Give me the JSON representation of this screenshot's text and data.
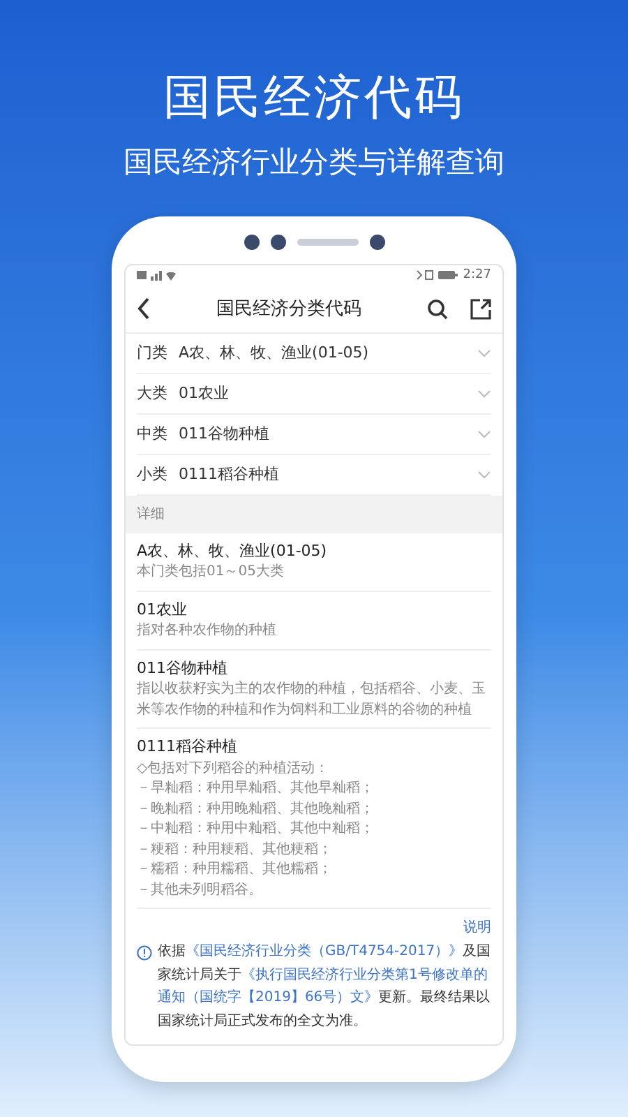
{
  "headline": "国民经济代码",
  "subtitle": "国民经济行业分类与详解查询",
  "status_bar": {
    "time": "2:27"
  },
  "nav": {
    "title": "国民经济分类代码"
  },
  "selectors": [
    {
      "label": "门类",
      "value": "A农、林、牧、渔业(01-05)"
    },
    {
      "label": "大类",
      "value": "01农业"
    },
    {
      "label": "中类",
      "value": "011谷物种植"
    },
    {
      "label": "小类",
      "value": "0111稻谷种植"
    }
  ],
  "details_header": "详细",
  "details": [
    {
      "title": "A农、林、牧、渔业(01-05)",
      "lines": [
        "本门类包括01～05大类"
      ]
    },
    {
      "title": "01农业",
      "lines": [
        "指对各种农作物的种植"
      ]
    },
    {
      "title": "011谷物种植",
      "lines": [
        "指以收获籽实为主的农作物的种植，包括稻谷、小麦、玉米等农作物的种植和作为饲料和工业原料的谷物的种植"
      ]
    },
    {
      "title": "0111稻谷种植",
      "lines": [
        "◇包括对下列稻谷的种植活动：",
        "－早籼稻：种用早籼稻、其他早籼稻；",
        "－晚籼稻：种用晚籼稻、其他晚籼稻；",
        "－中籼稻：种用中籼稻、其他中籼稻；",
        "－粳稻：种用粳稻、其他粳稻；",
        "－糯稻：种用糯稻、其他糯稻；",
        "－其他未列明稻谷。"
      ]
    }
  ],
  "note": {
    "link": "说明",
    "parts": [
      {
        "kind": "text",
        "text": "依据"
      },
      {
        "kind": "title",
        "text": "《国民经济行业分类（GB/T4754-2017）》"
      },
      {
        "kind": "text",
        "text": "及国家统计局关于"
      },
      {
        "kind": "title",
        "text": "《执行国民经济行业分类第1号修改单的通知（国统字【2019】66号）文》"
      },
      {
        "kind": "text",
        "text": "更新。最终结果以国家统计局正式发布的全文为准。"
      }
    ]
  }
}
